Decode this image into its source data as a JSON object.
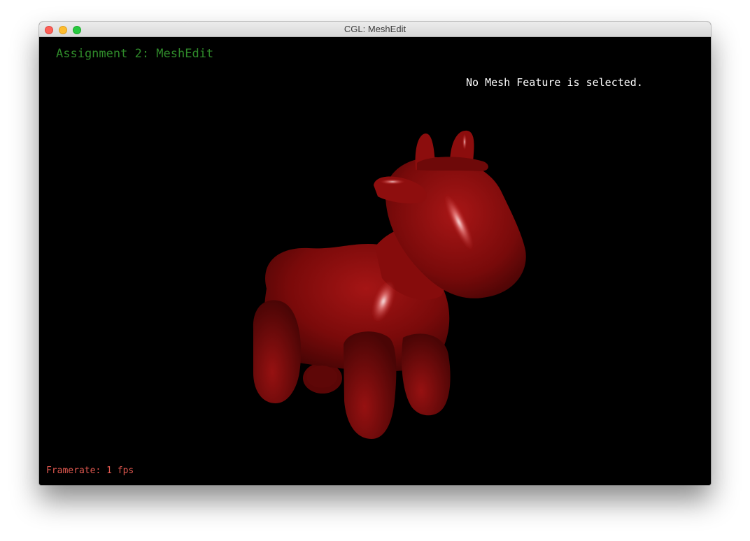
{
  "window": {
    "title": "CGL: MeshEdit"
  },
  "viewport": {
    "heading": "Assignment 2: MeshEdit",
    "status": "No Mesh Feature is selected.",
    "framerate": "Framerate: 1 fps"
  },
  "colors": {
    "heading": "#2f8a2a",
    "status": "#ffffff",
    "framerate": "#e0584f",
    "mesh": "#8a0d0d",
    "background": "#000000"
  },
  "mesh": {
    "subject": "cow-model"
  }
}
